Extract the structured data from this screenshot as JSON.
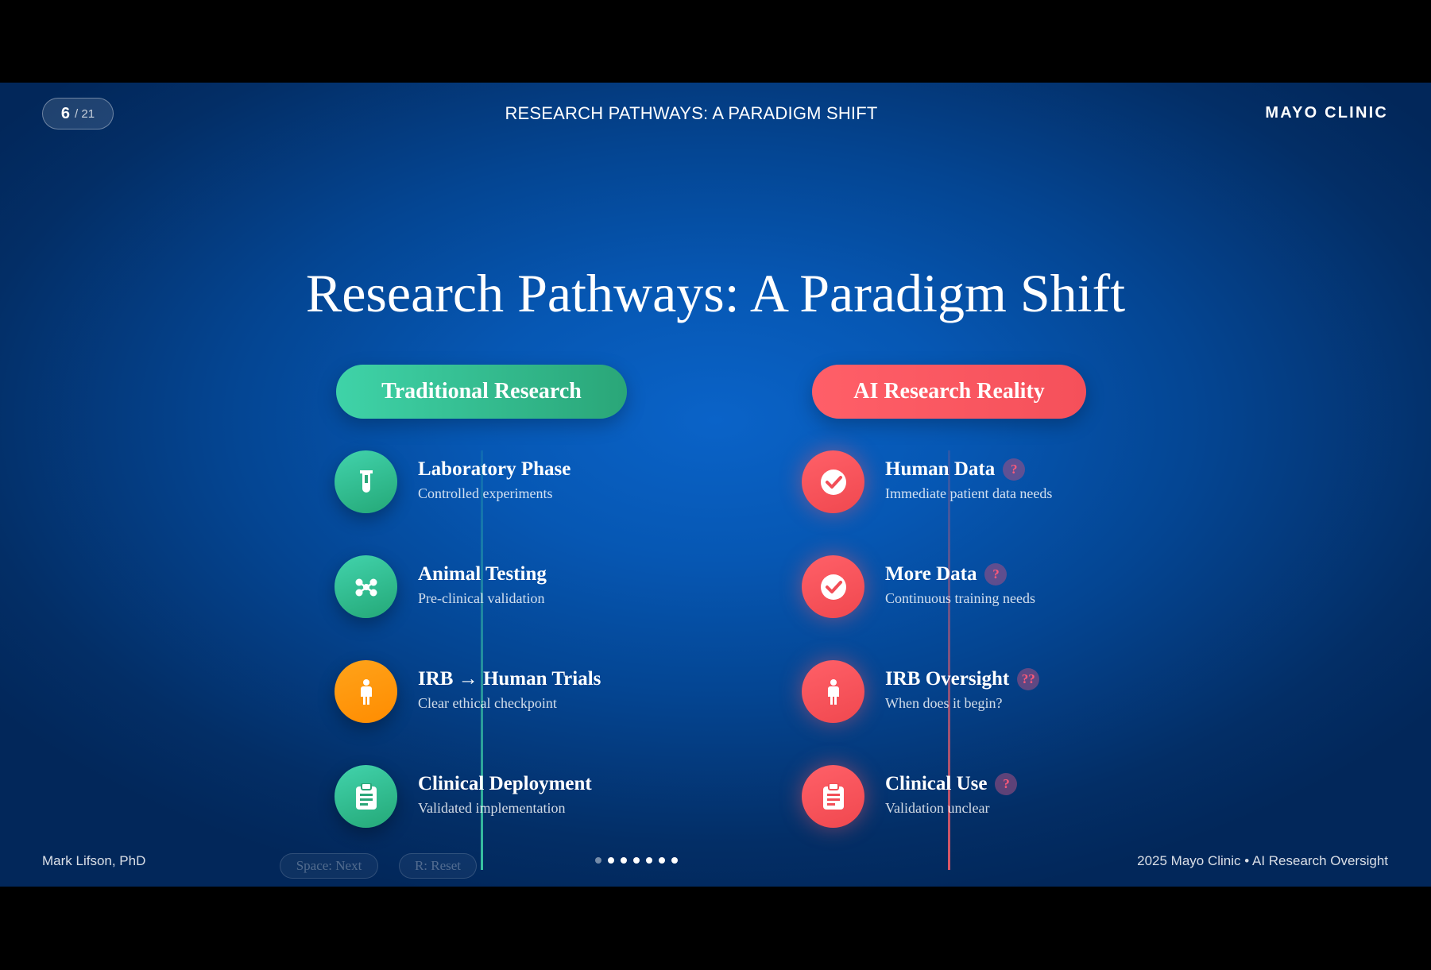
{
  "header": {
    "slide_current": "6",
    "slide_total": "/ 21",
    "title": "RESEARCH PATHWAYS: A PARADIGM SHIFT",
    "brand": "MAYO CLINIC"
  },
  "main_title": "Research Pathways: A Paradigm Shift",
  "left_column": {
    "label": "Traditional Research",
    "steps": [
      {
        "title": "Laboratory Phase",
        "subtitle": "Controlled experiments",
        "icon": "test-tube-icon",
        "color": "#2fbf8c"
      },
      {
        "title": "Animal Testing",
        "subtitle": "Pre-clinical validation",
        "icon": "molecule-icon",
        "color": "#2fbf8c"
      },
      {
        "title": "IRB → Human Trials",
        "subtitle": "Clear ethical checkpoint",
        "icon": "person-icon",
        "color": "#ff9800"
      },
      {
        "title": "Clinical Deployment",
        "subtitle": "Validated implementation",
        "icon": "clipboard-icon",
        "color": "#2fbf8c"
      }
    ]
  },
  "right_column": {
    "label": "AI Research Reality",
    "steps": [
      {
        "title": "Human Data",
        "badge": "?",
        "subtitle": "Immediate patient data needs",
        "icon": "check-circle-icon",
        "color": "#f7545d"
      },
      {
        "title": "More Data",
        "badge": "?",
        "subtitle": "Continuous training needs",
        "icon": "check-circle-icon",
        "color": "#f7545d"
      },
      {
        "title": "IRB Oversight",
        "badge": "??",
        "subtitle": "When does it begin?",
        "icon": "person-icon",
        "color": "#f7545d"
      },
      {
        "title": "Clinical Use",
        "badge": "?",
        "subtitle": "Validation unclear",
        "icon": "clipboard-icon",
        "color": "#f7545d"
      }
    ]
  },
  "footer": {
    "author": "Mark Lifson, PhD",
    "space_hint": "Space: Next",
    "reset_hint": "R: Reset",
    "copyright": "2025 Mayo Clinic • AI Research Oversight",
    "progress_dots_total": 7,
    "progress_dots_active_from": 2
  }
}
